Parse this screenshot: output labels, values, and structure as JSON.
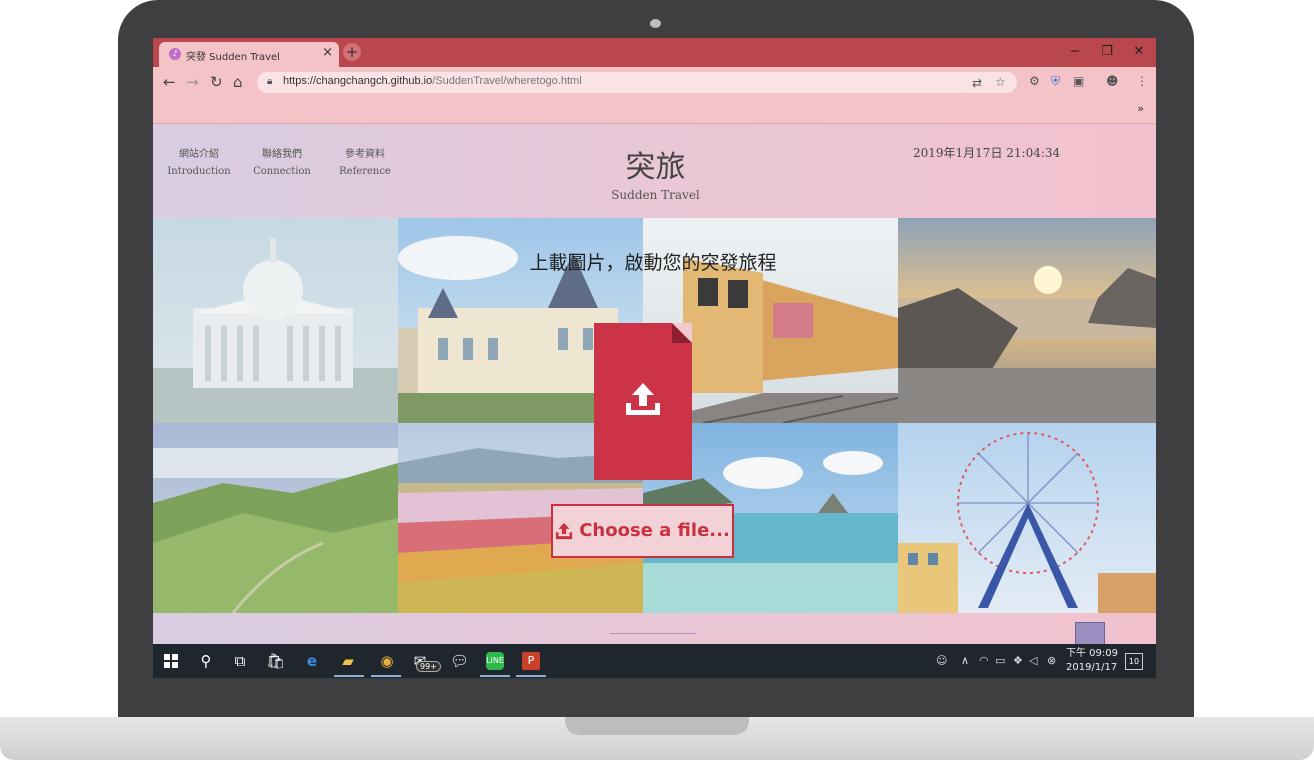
{
  "browser": {
    "tab_title": "突發 Sudden Travel",
    "tab_close": "×",
    "new_tab": "+",
    "url_host": "https://changchangch.github.io",
    "url_path": "/SuddenTravel/wheretogo.html",
    "bookmarks_more": "»",
    "window_controls": {
      "minimize": "−",
      "restore": "❐",
      "close": "✕"
    }
  },
  "site": {
    "nav": [
      {
        "zh": "網站介紹",
        "en": "Introduction"
      },
      {
        "zh": "聯絡我們",
        "en": "Connection"
      },
      {
        "zh": "參考資料",
        "en": "Reference"
      }
    ],
    "title": "突旅",
    "subtitle": "Sudden Travel",
    "datetime": "2019年1月17日 21:04:34",
    "upload_heading": "上載圖片，啟動您的突發旅程",
    "choose_file_label": "Choose a file..."
  },
  "taskbar": {
    "badge": "99+",
    "time": "下午 09:09",
    "date": "2019/1/17",
    "notifications": "10"
  },
  "colors": {
    "accent": "#c8323f",
    "tab_bar": "#b9474d",
    "toolbar": "#f4c3c8",
    "taskbar": "#20262e"
  }
}
